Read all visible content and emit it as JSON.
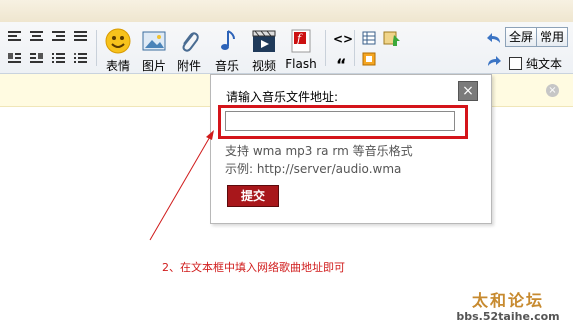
{
  "toolbar": {
    "buttons": [
      {
        "label": "表情",
        "icon": "smiley-icon"
      },
      {
        "label": "图片",
        "icon": "image-icon"
      },
      {
        "label": "附件",
        "icon": "paperclip-icon"
      },
      {
        "label": "音乐",
        "icon": "music-note-icon"
      },
      {
        "label": "视频",
        "icon": "film-icon"
      },
      {
        "label": "Flash",
        "icon": "flash-icon"
      }
    ],
    "code_label": "<>",
    "quote_label": "“",
    "fullscreen_label": "全屏",
    "common_label": "常用",
    "plain_text_label": "纯文本"
  },
  "popup": {
    "title": "请输入音乐文件地址:",
    "input_value": "",
    "support_text": "支持 wma mp3 ra rm 等音乐格式",
    "example_text": "示例: http://server/audio.wma",
    "submit_label": "提交",
    "close_label": "×"
  },
  "notice": {
    "close_label": "×"
  },
  "annotation": "2、在文本框中填入网络歌曲地址即可",
  "watermark": {
    "site_url": "bbs.52taihe.com",
    "logo_text": "太和论坛"
  },
  "colors": {
    "accent_red": "#d4141a",
    "submit_bg": "#a8171b",
    "notice_bg": "#fffbe1"
  }
}
